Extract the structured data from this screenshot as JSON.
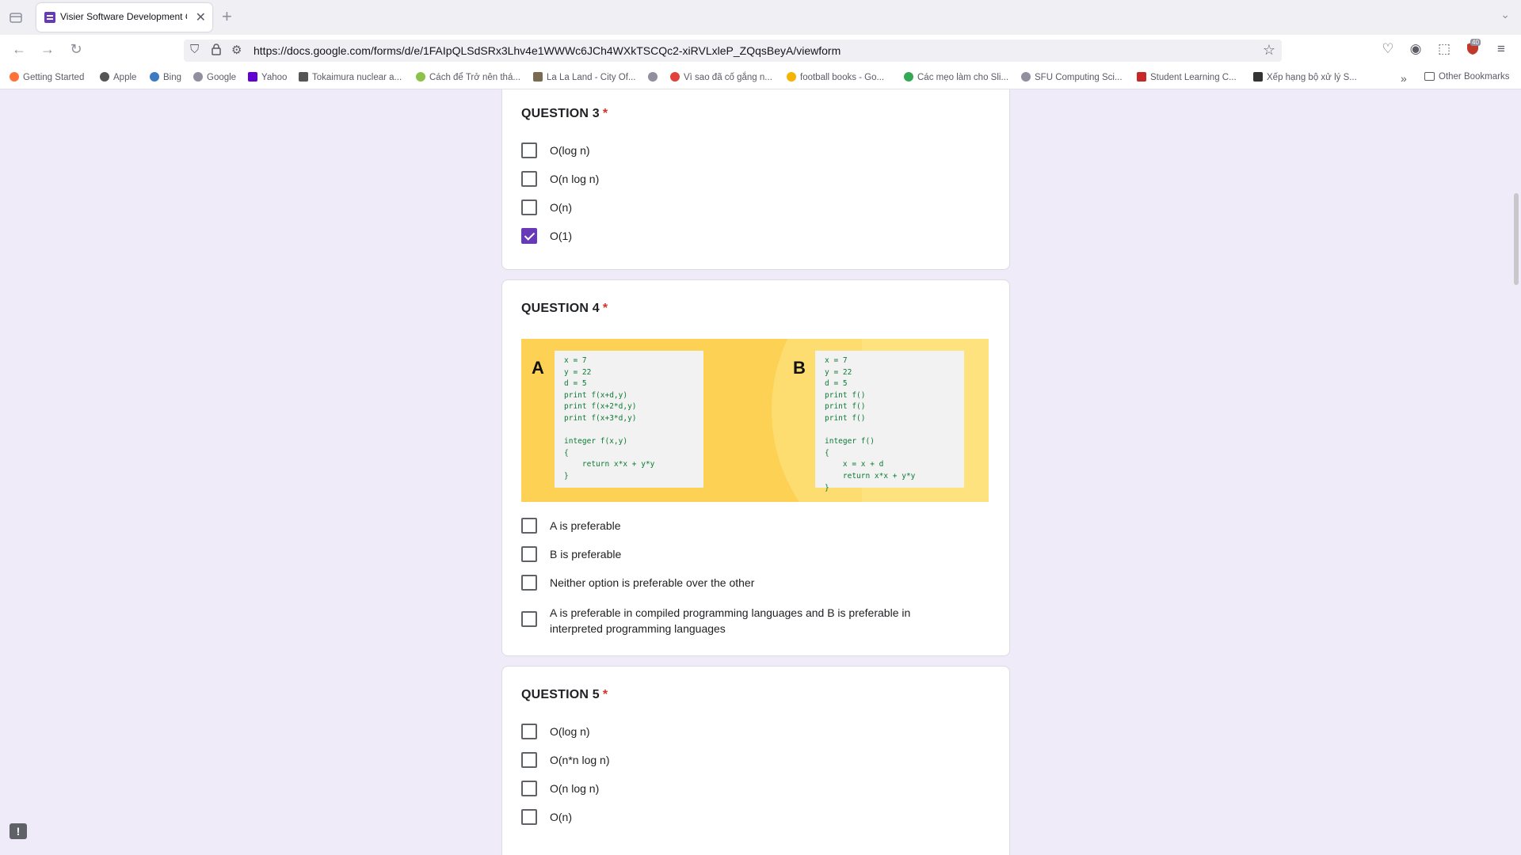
{
  "browser": {
    "tab_title": "Visier Software Development C",
    "new_tab_label": "+",
    "url": "https://docs.google.com/forms/d/e/1FAIpQLSdSRx3Lhv4e1WWWc6JCh4WXkTSCQc2-xiRVLxleP_ZQqsBeyA/viewform",
    "extension_badge": "40"
  },
  "bookmarks": [
    {
      "label": "Getting Started",
      "color": "#ff7139"
    },
    {
      "label": "Apple",
      "color": "#555555"
    },
    {
      "label": "Bing",
      "color": "#3c7ac4"
    },
    {
      "label": "Google",
      "color": "#8f8f9d"
    },
    {
      "label": "Yahoo",
      "color": "#6001d2"
    },
    {
      "label": "Tokaimura nuclear a...",
      "color": "#555555"
    },
    {
      "label": "Cách để Trở nên thá...",
      "color": "#8bc34a"
    },
    {
      "label": "La La Land - City Of...",
      "color": "#7a6a50"
    },
    {
      "label": "",
      "color": "#8f8f9d"
    },
    {
      "label": "Vì sao đã cố gắng n...",
      "color": "#e0413a"
    },
    {
      "label": "football books - Go...",
      "color": "#f4b400"
    },
    {
      "label": "Các mẹo làm cho Sli...",
      "color": "#34a853"
    },
    {
      "label": "SFU Computing Sci...",
      "color": "#8f8f9d"
    },
    {
      "label": "Student Learning C...",
      "color": "#c62828"
    },
    {
      "label": "Xếp hạng bộ xử lý S...",
      "color": "#333333"
    }
  ],
  "other_bookmarks": "Other Bookmarks",
  "questions": {
    "q3": {
      "title": "QUESTION 3",
      "required_mark": "*",
      "options": [
        {
          "label": "O(log n)",
          "checked": false
        },
        {
          "label": "O(n log n)",
          "checked": false
        },
        {
          "label": "O(n)",
          "checked": false
        },
        {
          "label": "O(1)",
          "checked": true
        }
      ]
    },
    "q4": {
      "title": "QUESTION 4",
      "required_mark": "*",
      "image": {
        "label_a": "A",
        "code_a": "x = 7\ny = 22\nd = 5\nprint f(x+d,y)\nprint f(x+2*d,y)\nprint f(x+3*d,y)\n\ninteger f(x,y)\n{\n    return x*x + y*y\n}",
        "label_b": "B",
        "code_b": "x = 7\ny = 22\nd = 5\nprint f()\nprint f()\nprint f()\n\ninteger f()\n{\n    x = x + d\n    return x*x + y*y\n}"
      },
      "options": [
        {
          "label": "A is preferable",
          "checked": false
        },
        {
          "label": "B is preferable",
          "checked": false
        },
        {
          "label": "Neither option is preferable over the other",
          "checked": false
        },
        {
          "label": "A is preferable in compiled programming languages and B is preferable in interpreted programming languages",
          "checked": false
        }
      ]
    },
    "q5": {
      "title": "QUESTION 5",
      "required_mark": "*",
      "options": [
        {
          "label": "O(log n)",
          "checked": false
        },
        {
          "label": "O(n*n log n)",
          "checked": false
        },
        {
          "label": "O(n log n)",
          "checked": false
        },
        {
          "label": "O(n)",
          "checked": false
        }
      ]
    }
  },
  "feedback_icon": "!"
}
